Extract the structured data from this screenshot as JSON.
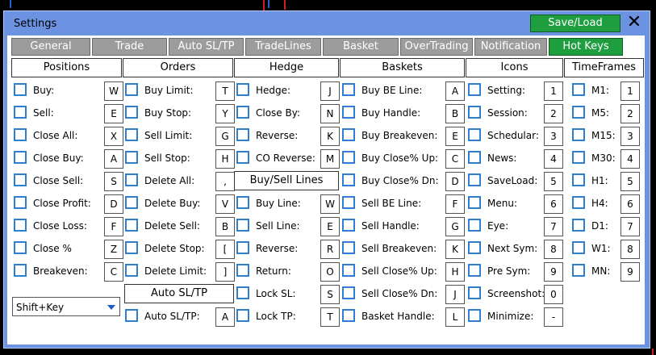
{
  "window": {
    "title": "Settings",
    "save_load": "Save/Load",
    "close": "✕"
  },
  "tabs": [
    {
      "label": "General"
    },
    {
      "label": "Trade"
    },
    {
      "label": "Auto SL/TP"
    },
    {
      "label": "TradeLines"
    },
    {
      "label": "Basket"
    },
    {
      "label": "OverTrading"
    },
    {
      "label": "Notification"
    },
    {
      "label": "Hot Keys",
      "active": true
    }
  ],
  "columns": {
    "positions": {
      "header": "Positions",
      "items": [
        {
          "label": "Buy:",
          "key": "W"
        },
        {
          "label": "Sell:",
          "key": "E"
        },
        {
          "label": "Close All:",
          "key": "X"
        },
        {
          "label": "Close Buy:",
          "key": "A"
        },
        {
          "label": "Close Sell:",
          "key": "S"
        },
        {
          "label": "Close Profit:",
          "key": "D"
        },
        {
          "label": "Close Loss:",
          "key": "F"
        },
        {
          "label": "Close %",
          "key": "Z"
        },
        {
          "label": "Breakeven:",
          "key": "C"
        }
      ],
      "modifier": "Shift+Key"
    },
    "orders": {
      "header": "Orders",
      "items": [
        {
          "label": "Buy Limit:",
          "key": "T"
        },
        {
          "label": "Buy Stop:",
          "key": "Y"
        },
        {
          "label": "Sell Limit:",
          "key": "G"
        },
        {
          "label": "Sell Stop:",
          "key": "H"
        },
        {
          "label": "Delete All:",
          "key": ","
        },
        {
          "label": "Delete Buy:",
          "key": "V"
        },
        {
          "label": "Delete Sell:",
          "key": "B"
        },
        {
          "label": "Delete Stop:",
          "key": "["
        },
        {
          "label": "Delete Limit:",
          "key": "]"
        }
      ],
      "sub_header": "Auto SL/TP",
      "sub_items": [
        {
          "label": "Auto SL/TP:",
          "key": "A"
        }
      ]
    },
    "hedge": {
      "header": "Hedge",
      "items": [
        {
          "label": "Hedge:",
          "key": "J"
        },
        {
          "label": "Close By:",
          "key": "N"
        },
        {
          "label": "Reverse:",
          "key": "K"
        },
        {
          "label": "CO Reverse:",
          "key": "M"
        }
      ],
      "sub_header": "Buy/Sell Lines",
      "sub_items": [
        {
          "label": "Buy Line:",
          "key": "W"
        },
        {
          "label": "Sell Line:",
          "key": "E"
        },
        {
          "label": "Reverse:",
          "key": "R"
        },
        {
          "label": "Return:",
          "key": "O"
        },
        {
          "label": "Lock SL:",
          "key": "S"
        },
        {
          "label": "Lock TP:",
          "key": "T"
        }
      ]
    },
    "baskets": {
      "header": "Baskets",
      "items": [
        {
          "label": "Buy BE Line:",
          "key": "A"
        },
        {
          "label": "Buy Handle:",
          "key": "B"
        },
        {
          "label": "Buy Breakeven:",
          "key": "E"
        },
        {
          "label": "Buy Close% Up:",
          "key": "C"
        },
        {
          "label": "Buy Close% Dn:",
          "key": "D"
        },
        {
          "label": "Sell BE Line:",
          "key": "F"
        },
        {
          "label": "Sell Handle:",
          "key": "G"
        },
        {
          "label": "Sell Breakeven:",
          "key": "K"
        },
        {
          "label": "Sell Close% Up:",
          "key": "H"
        },
        {
          "label": "Sell Close% Dn:",
          "key": "J"
        },
        {
          "label": "Basket Handle:",
          "key": "L"
        }
      ]
    },
    "icons": {
      "header": "Icons",
      "items": [
        {
          "label": "Setting:",
          "key": "1"
        },
        {
          "label": "Session:",
          "key": "2"
        },
        {
          "label": "Schedular:",
          "key": "3"
        },
        {
          "label": "News:",
          "key": "4"
        },
        {
          "label": "SaveLoad:",
          "key": "5"
        },
        {
          "label": "Menu:",
          "key": "6"
        },
        {
          "label": "Eye:",
          "key": "7"
        },
        {
          "label": "Next Sym:",
          "key": "8"
        },
        {
          "label": "Pre Sym:",
          "key": "9"
        },
        {
          "label": "Screenshot:",
          "key": "0"
        },
        {
          "label": "Minimize:",
          "key": "-"
        }
      ]
    },
    "timeframes": {
      "header": "TimeFrames",
      "items": [
        {
          "label": "M1:",
          "key": "1"
        },
        {
          "label": "M5:",
          "key": "2"
        },
        {
          "label": "M15:",
          "key": "3"
        },
        {
          "label": "M30:",
          "key": "4"
        },
        {
          "label": "H1:",
          "key": "5"
        },
        {
          "label": "H4:",
          "key": "6"
        },
        {
          "label": "D1:",
          "key": "7"
        },
        {
          "label": "W1:",
          "key": "8"
        },
        {
          "label": "MN:",
          "key": "9"
        }
      ]
    }
  },
  "colors": {
    "panel": "#6c93e2",
    "active_tab": "#1f9e40",
    "inactive_tab": "#9c9c9c",
    "checkbox": "#2f7fd0"
  }
}
